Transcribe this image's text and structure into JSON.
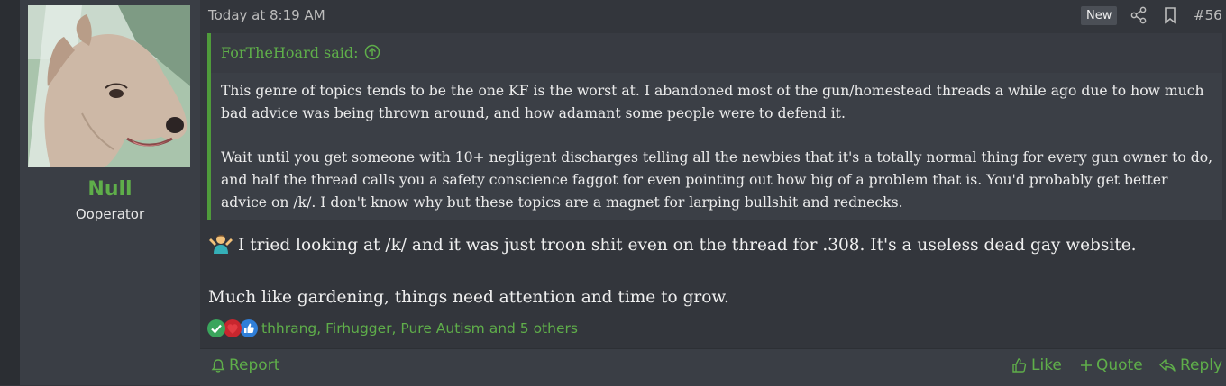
{
  "user": {
    "name": "Null",
    "title": "Ooperator"
  },
  "post": {
    "date": "Today at 8:19 AM",
    "badge": "New",
    "number": "#56",
    "quote": {
      "author_said": "ForTheHoard said:",
      "paragraphs": [
        "This genre of topics tends to be the one KF is the worst at. I abandoned most of the gun/homestead threads a while ago due to how much bad advice was being thrown around, and how adamant some people were to defend it.",
        "Wait until you get someone with 10+ negligent discharges telling all the newbies that it's a totally normal thing for every gun owner to do, and half the thread calls you a safety conscience faggot for even pointing out how big of a problem that is. You'd probably get better advice on /k/. I don't know why but these topics are a magnet for larping bullshit and rednecks."
      ]
    },
    "message": [
      "I tried looking at /k/ and it was just troon shit even on the thread for .308. It's a useless dead gay website.",
      "Much like gardening, things need attention and time to grow."
    ],
    "reactions": {
      "icons": [
        "check-icon",
        "heart-icon",
        "thumbs-up-icon"
      ],
      "text": "thhrang, Firhugger, Pure Autism and 5 others"
    }
  },
  "footer": {
    "report": "Report",
    "like": "Like",
    "quote": "Quote",
    "reply": "Reply"
  },
  "colors": {
    "accent": "#5fae4a",
    "background": "#33363c",
    "user_column": "#3a3e45"
  }
}
